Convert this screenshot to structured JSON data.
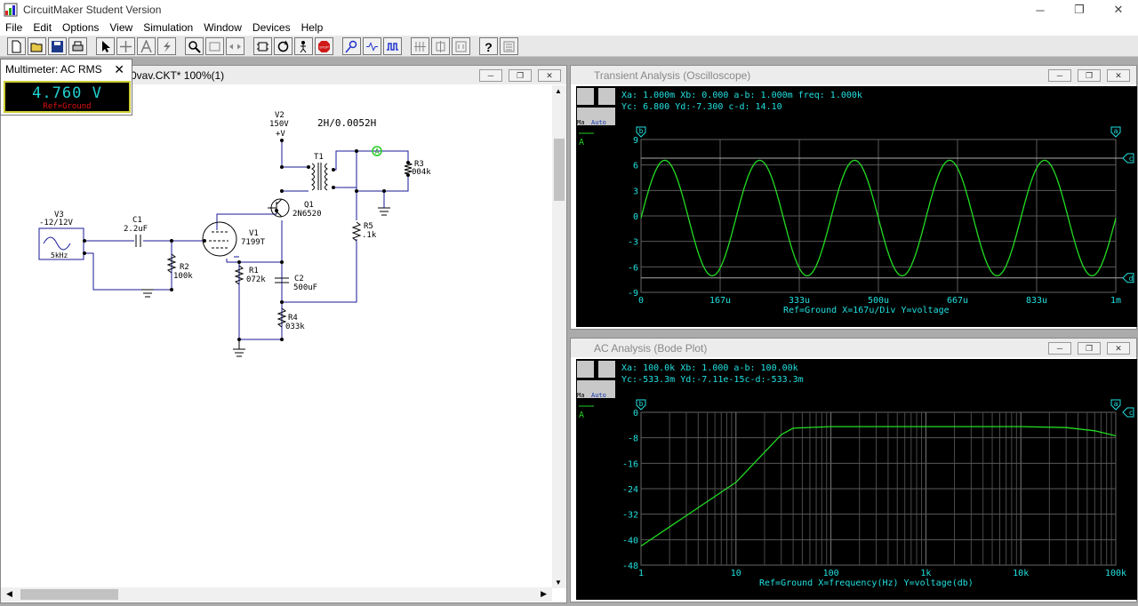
{
  "app": {
    "title": "CircuitMaker Student Version"
  },
  "menu": [
    "File",
    "Edit",
    "Options",
    "View",
    "Simulation",
    "Window",
    "Devices",
    "Help"
  ],
  "multimeter": {
    "title": "Multimeter: AC RMS",
    "value": "4.760 V",
    "ref": "Ref=Ground"
  },
  "schematic": {
    "title": "0vav.CKT* 100%(1)",
    "labels": {
      "v2_name": "V2",
      "v2_value": "150V",
      "v2_sym": "+V",
      "t1_spec": "2H/0.0052H",
      "t1_name": "T1",
      "r3_name": "R3",
      "r3_value": "004k",
      "q1_name": "Q1",
      "q1_part": "2N6520",
      "v3_name": "V3",
      "v3_value": "-12/12V",
      "v3_freq": "5kHz",
      "c1_name": "C1",
      "c1_value": "2.2uF",
      "v1_name": "V1",
      "v1_part": "7199T",
      "r5_name": "R5",
      "r5_value": ".1k",
      "r2_name": "R2",
      "r2_value": "100k",
      "r1_name": "R1",
      "r1_value": "072k",
      "c2_name": "C2",
      "c2_value": "500uF",
      "r4_name": "R4",
      "r4_value": "033k",
      "probe_a": "A"
    }
  },
  "transient": {
    "title": "Transient Analysis (Oscilloscope)",
    "readout1": "Xa: 1.000m  Xb: 0.000   a-b: 1.000m freq: 1.000k",
    "readout2": "Yc: 6.800   Yd:-7.300   c-d: 14.10",
    "trace": "A",
    "y_ticks": [
      "9",
      "6",
      "3",
      "0",
      "-3",
      "-6",
      "-9"
    ],
    "x_ticks": [
      "0",
      "167u",
      "333u",
      "500u",
      "667u",
      "833u",
      "1m"
    ],
    "footer": "Ref=Ground  X=167u/Div Y=voltage",
    "cursors": [
      "b",
      "a",
      "c",
      "d"
    ]
  },
  "bode": {
    "title": "AC Analysis (Bode Plot)",
    "readout1": "Xa: 100.0k  Xb: 1.000   a-b: 100.00k",
    "readout2": "Yc:-533.3m  Yd:-7.11e-15c-d:-533.3m",
    "trace": "A",
    "y_ticks": [
      "0",
      "-8",
      "-16",
      "-24",
      "-32",
      "-40",
      "-48"
    ],
    "x_ticks": [
      "1",
      "10",
      "100",
      "1k",
      "10k",
      "100k"
    ],
    "footer": "Ref=Ground  X=frequency(Hz) Y=voltage(db)",
    "cursors": [
      "b",
      "a",
      "c"
    ]
  },
  "tool_buttons": {
    "mini_a": "Ma",
    "auto": "Auto"
  },
  "chart_data": [
    {
      "type": "line",
      "title": "Transient Analysis (Oscilloscope)",
      "xlabel": "X=167u/Div",
      "ylabel": "Y=voltage",
      "xlim": [
        0,
        0.001
      ],
      "ylim": [
        -9,
        9
      ],
      "series": [
        {
          "name": "A",
          "function": "sine",
          "amplitude": 6.8,
          "offset": -0.25,
          "frequency_hz": 5000,
          "start": [
            0,
            0
          ]
        }
      ],
      "grid": true
    },
    {
      "type": "line",
      "title": "AC Analysis (Bode Plot)",
      "xlabel": "X=frequency(Hz)",
      "ylabel": "Y=voltage(db)",
      "xscale": "log",
      "xlim": [
        1,
        100000
      ],
      "ylim": [
        -48,
        0
      ],
      "series": [
        {
          "name": "A",
          "x": [
            1,
            10,
            30,
            40,
            100,
            1000,
            10000,
            30000,
            60000,
            100000
          ],
          "y": [
            -42,
            -22,
            -7,
            -5,
            -4.5,
            -4.5,
            -4.5,
            -4.8,
            -5.8,
            -7.4
          ]
        }
      ],
      "grid": true
    }
  ]
}
